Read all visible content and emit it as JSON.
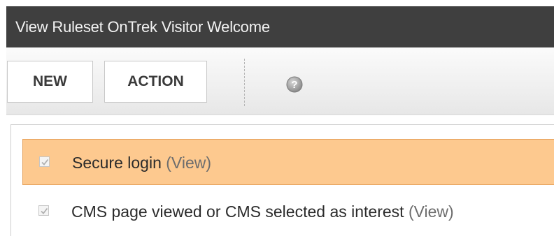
{
  "window": {
    "title": "View Ruleset OnTrek Visitor Welcome"
  },
  "toolbar": {
    "new_label": "NEW",
    "action_label": "ACTION",
    "help_icon": "help-icon"
  },
  "rules": [
    {
      "label": "Secure login",
      "link": "(View)",
      "checked": true,
      "selected": true
    },
    {
      "label": "CMS page viewed or CMS selected as interest",
      "link": "(View)",
      "checked": true,
      "selected": false
    }
  ],
  "colors": {
    "titlebar": "#3f3f3f",
    "selected_row": "#fdc98f",
    "link": "#6d6d6d"
  }
}
